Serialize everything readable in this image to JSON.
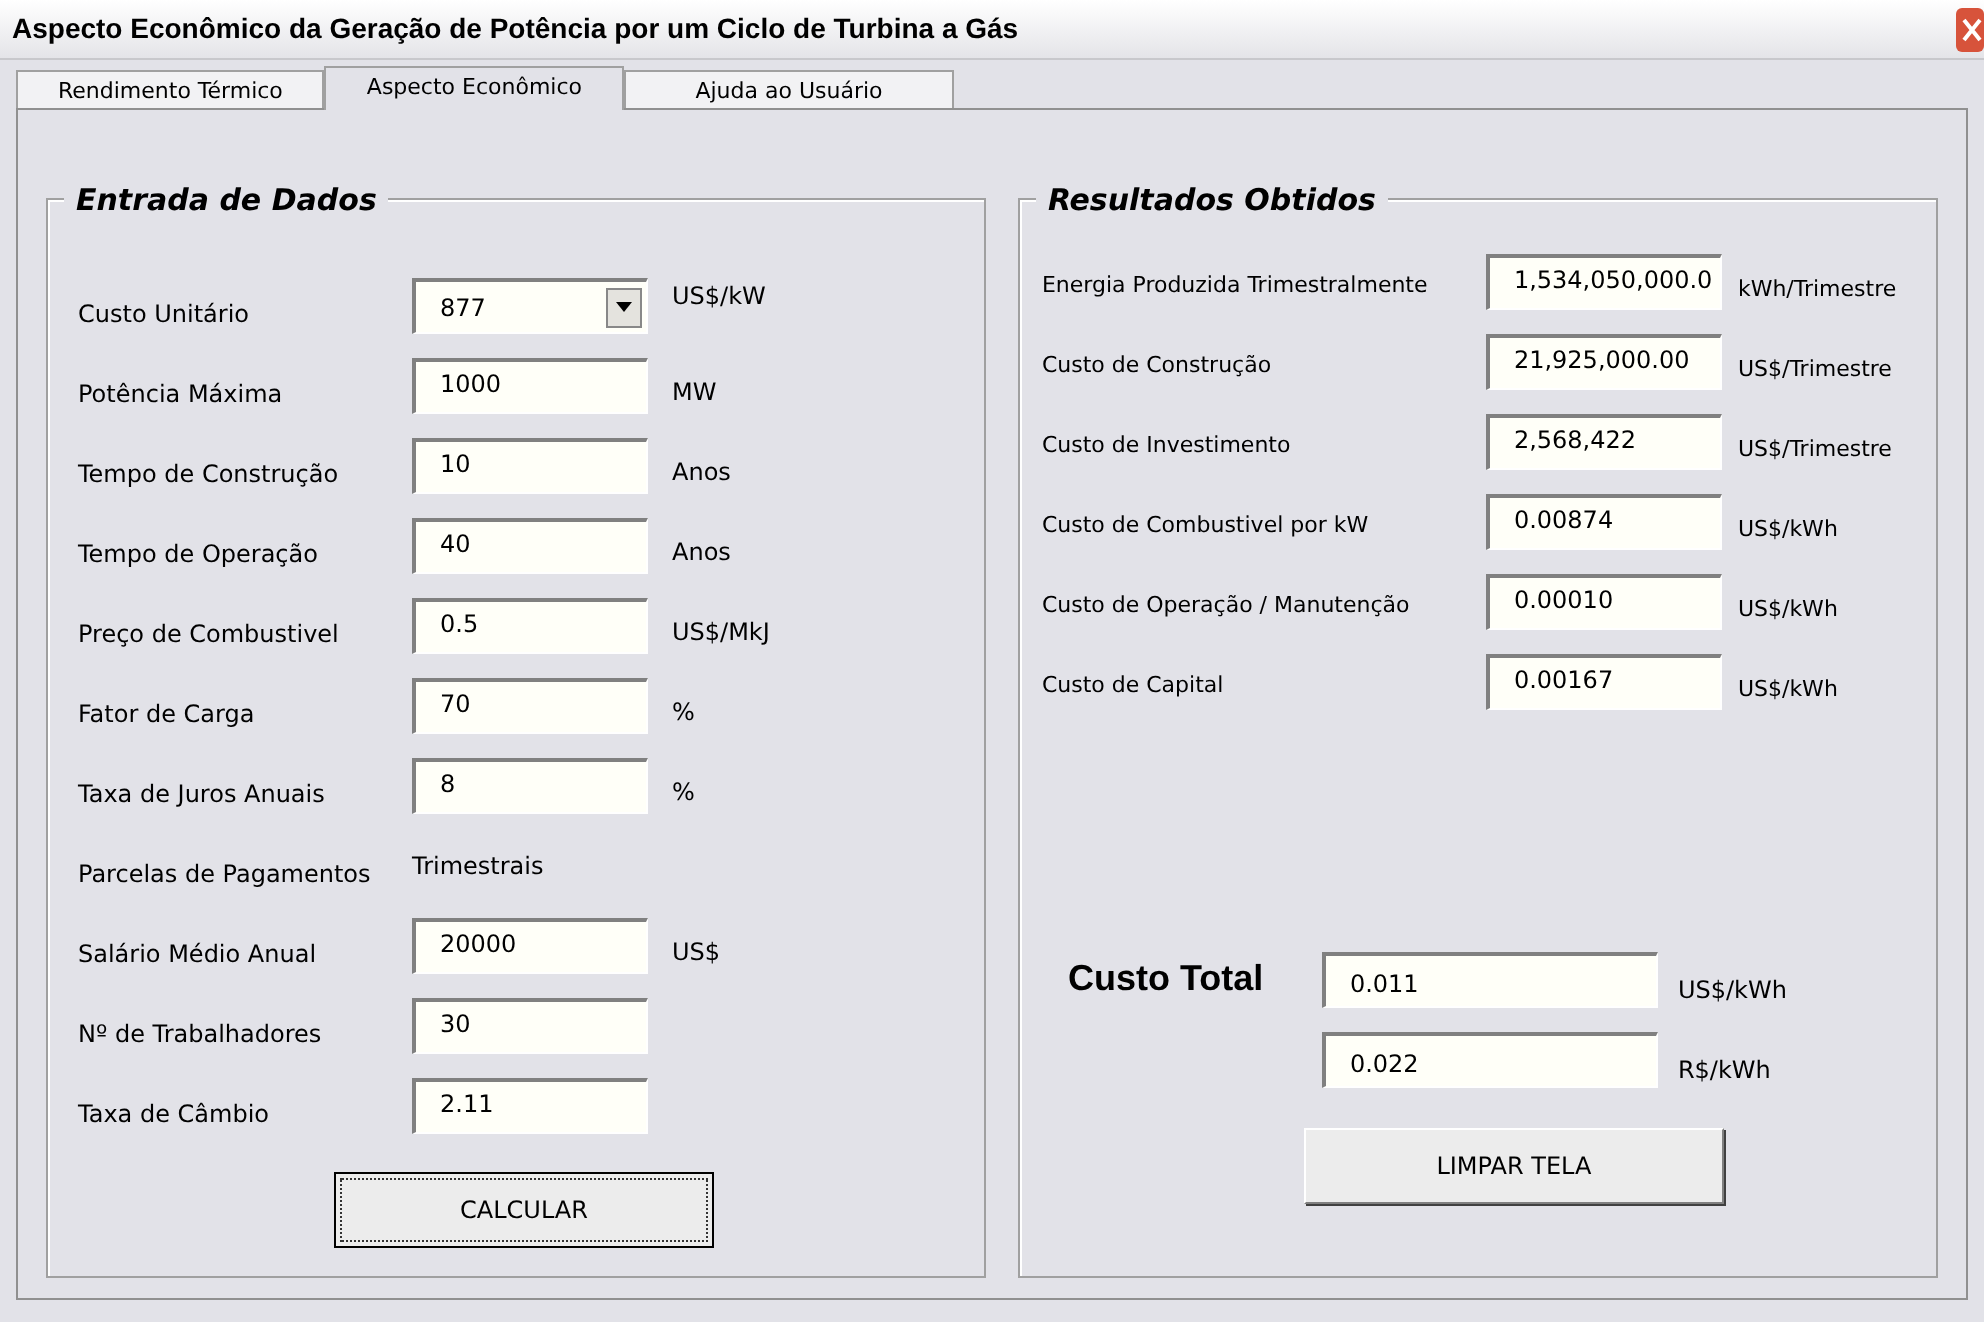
{
  "window": {
    "title": "Aspecto Econômico da Geração de Potência por um Ciclo de Turbina a Gás"
  },
  "tabs": [
    {
      "label": "Rendimento Térmico",
      "selected": false
    },
    {
      "label": "Aspecto Econômico",
      "selected": true
    },
    {
      "label": "Ajuda ao Usuário",
      "selected": false
    }
  ],
  "input_group": {
    "title": "Entrada de Dados",
    "rows": [
      {
        "kind": "dropdown",
        "label": "Custo Unitário",
        "value": "877",
        "unit": "US$/kW"
      },
      {
        "kind": "field",
        "label": "Potência Máxima",
        "value": "1000",
        "unit": "MW"
      },
      {
        "kind": "field",
        "label": "Tempo de Construção",
        "value": "10",
        "unit": "Anos"
      },
      {
        "kind": "field",
        "label": "Tempo de Operação",
        "value": "40",
        "unit": "Anos"
      },
      {
        "kind": "field",
        "label": "Preço de Combustivel",
        "value": "0.5",
        "unit": "US$/MkJ"
      },
      {
        "kind": "field",
        "label": "Fator de Carga",
        "value": "70",
        "unit": "%"
      },
      {
        "kind": "field",
        "label": "Taxa de Juros Anuais",
        "value": "8",
        "unit": "%"
      },
      {
        "kind": "text",
        "label": "Parcelas de Pagamentos",
        "value": "Trimestrais"
      },
      {
        "kind": "field",
        "label": "Salário Médio Anual",
        "value": "20000",
        "unit": "US$"
      },
      {
        "kind": "field",
        "label": "Nº de Trabalhadores",
        "value": "30"
      },
      {
        "kind": "field",
        "label": "Taxa de Câmbio",
        "value": "2.11"
      }
    ],
    "button": "CALCULAR"
  },
  "results_group": {
    "title": "Resultados Obtidos",
    "rows": [
      {
        "label": "Energia Produzida Trimestralmente",
        "value": "1,534,050,000.0",
        "unit": "kWh/Trimestre"
      },
      {
        "label": "Custo de Construção",
        "value": "21,925,000.00",
        "unit": "US$/Trimestre"
      },
      {
        "label": "Custo de Investimento",
        "value": "2,568,422",
        "unit": "US$/Trimestre"
      },
      {
        "label": "Custo de Combustivel por kW",
        "value": "0.00874",
        "unit": "US$/kWh"
      },
      {
        "label": "Custo de Operação / Manutenção",
        "value": "0.00010",
        "unit": "US$/kWh"
      },
      {
        "label": "Custo de Capital",
        "value": "0.00167",
        "unit": "US$/kWh"
      }
    ],
    "total_label": "Custo Total",
    "totals": [
      {
        "value": "0.011",
        "unit": "US$/kWh"
      },
      {
        "value": "0.022",
        "unit": "R$/kWh"
      }
    ],
    "button": "LIMPAR TELA"
  }
}
